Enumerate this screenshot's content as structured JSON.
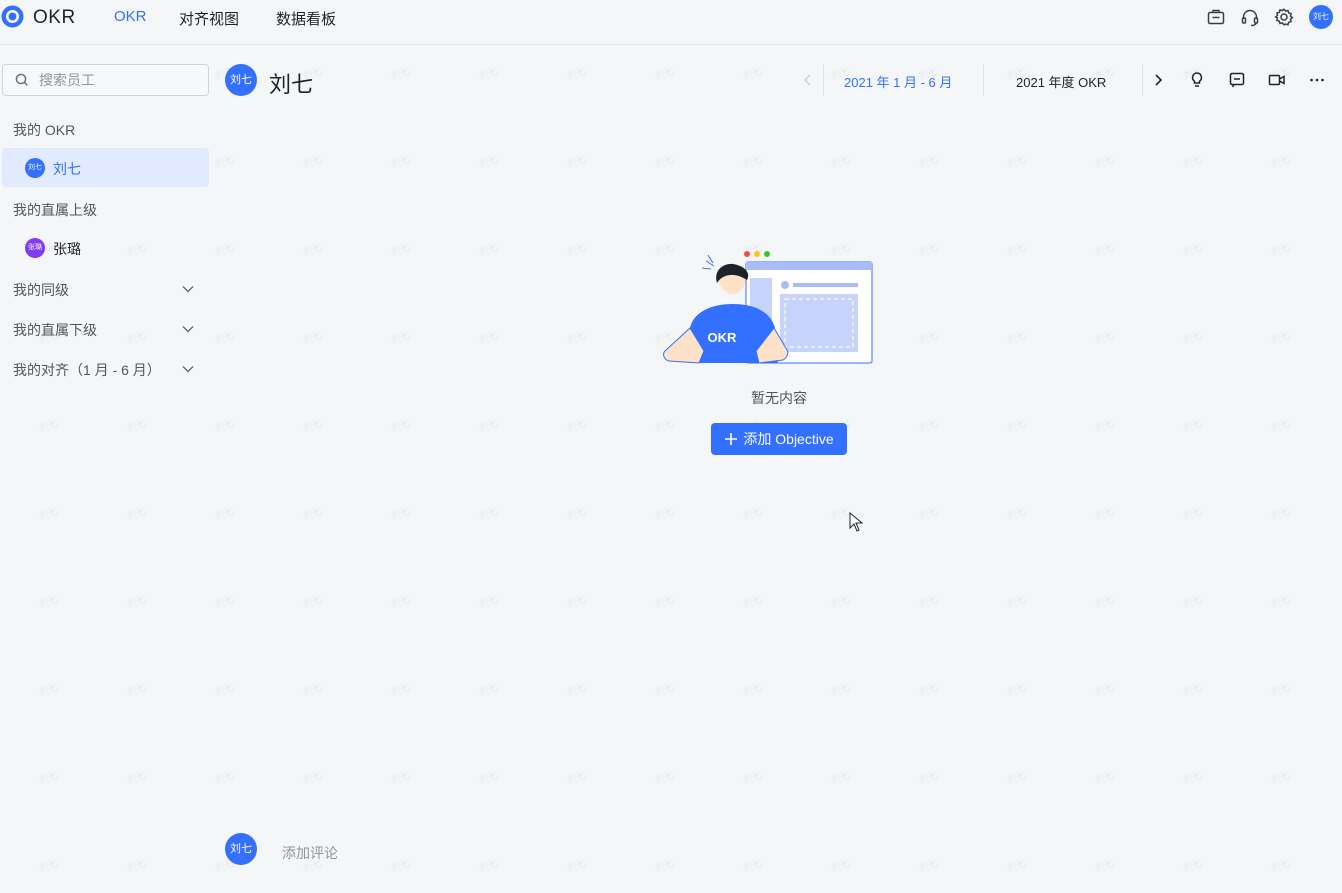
{
  "app": {
    "title": "OKR"
  },
  "nav": {
    "okr": "OKR",
    "align": "对齐视图",
    "dashboard": "数据看板"
  },
  "user": {
    "avatar_text": "刘七"
  },
  "search": {
    "placeholder": "搜索员工"
  },
  "sidebar": {
    "my_okr_label": "我的 OKR",
    "my_okr_person": {
      "avatar_text": "刘七",
      "name": "刘七"
    },
    "superior_label": "我的直属上级",
    "superior_person": {
      "avatar_text": "张璐",
      "name": "张璐"
    },
    "peers_label": "我的同级",
    "subordinates_label": "我的直属下级",
    "alignment_label": "我的对齐（1 月 - 6 月）"
  },
  "header": {
    "avatar_text": "刘七",
    "name": "刘七",
    "period_active": "2021 年 1 月 - 6 月",
    "period_year": "2021 年度 OKR"
  },
  "empty": {
    "illustration_text": "OKR",
    "text": "暂无内容",
    "add_label": "添加 Objective"
  },
  "comment": {
    "avatar_text": "刘七",
    "placeholder": "添加评论"
  },
  "colors": {
    "accent": "#3370ff",
    "selected_bg": "#e1eaff",
    "secondary_avatar": "#7f3bf5"
  }
}
